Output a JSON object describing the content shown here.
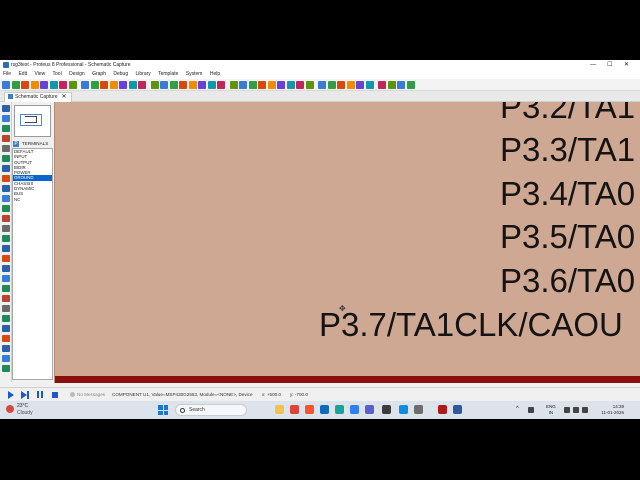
{
  "window": {
    "title": "rsg3test - Proteus 8 Professional - Schematic Capture",
    "minimize_glyph": "—",
    "maximize_glyph": "☐",
    "close_glyph": "✕"
  },
  "menu": [
    "File",
    "Edit",
    "View",
    "Tool",
    "Design",
    "Graph",
    "Debug",
    "Library",
    "Template",
    "System",
    "Help"
  ],
  "tab": {
    "label": "Schematic Capture",
    "close": "✕"
  },
  "object_selector": {
    "mode_button": "P",
    "header": "TERMINALS",
    "items": [
      "DEFAULT",
      "INPUT",
      "OUTPUT",
      "BIDIR",
      "POWER",
      "GROUND",
      "CHASSIS",
      "DYNAMIC",
      "BUS",
      "NC"
    ],
    "selected_index": 5
  },
  "canvas": {
    "pin_labels": [
      "P3.2/TA1",
      "P3.3/TA1",
      "P3.4/TA0",
      "P3.5/TA0",
      "P3.6/TA0",
      "P3.7/TA1CLK/CAOU"
    ],
    "background_color": "#cfa893",
    "strip_color": "#8b0f0f"
  },
  "status": {
    "messages": "No Messages",
    "component_info": "COMPONENT U1, Value=MSP430G2553, Module=<NONE>, Device",
    "x_label": "x:",
    "x_value": "+500.0",
    "y_label": "y:",
    "y_value": "-700.0"
  },
  "taskbar": {
    "weather_temp": "23°C",
    "weather_desc": "Cloudy",
    "search_placeholder": "Search",
    "lang_top": "ENG",
    "lang_bottom": "IN",
    "time": "14:39",
    "date": "11-01-2026"
  },
  "icons": {
    "toolbar": [
      "new-icon",
      "open-icon",
      "save-icon",
      "import-icon",
      "export-icon",
      "print-icon",
      "home-icon",
      "schematic-icon",
      "pcb-icon",
      "3d-icon",
      "gerber-icon",
      "bom-icon",
      "code-icon",
      "help-icon",
      "refresh-icon",
      "grid-icon",
      "origin-icon",
      "pan-icon",
      "zoom-in-icon",
      "zoom-out-icon",
      "zoom-all-icon",
      "zoom-area-icon",
      "undo-icon",
      "redo-icon",
      "cut-icon",
      "copy-icon",
      "paste-icon",
      "block-copy-icon",
      "block-move-icon",
      "block-rotate-icon",
      "block-delete-icon",
      "pick-device-icon",
      "make-device-icon",
      "packaging-icon",
      "decompose-icon",
      "wire-autorouter-icon",
      "search-tag-icon",
      "property-tool-icon",
      "new-sheet-icon",
      "remove-sheet-icon",
      "netlist-icon",
      "bill-of-materials-icon"
    ],
    "left_tools": [
      "select-icon",
      "component-icon",
      "junction-icon",
      "wire-label-icon",
      "text-script-icon",
      "bus-icon",
      "subcircuit-icon",
      "terminal-icon",
      "pin-icon",
      "graph-icon",
      "tape-icon",
      "generator-icon",
      "probe-voltage-icon",
      "probe-current-icon",
      "instrument-icon",
      "line-icon",
      "box-icon",
      "circle-icon",
      "arc-icon",
      "path-icon",
      "text-icon",
      "symbol-icon",
      "marker-icon",
      "rotate-cw-icon",
      "rotate-ccw-icon",
      "mirror-x-icon",
      "mirror-y-icon"
    ]
  }
}
